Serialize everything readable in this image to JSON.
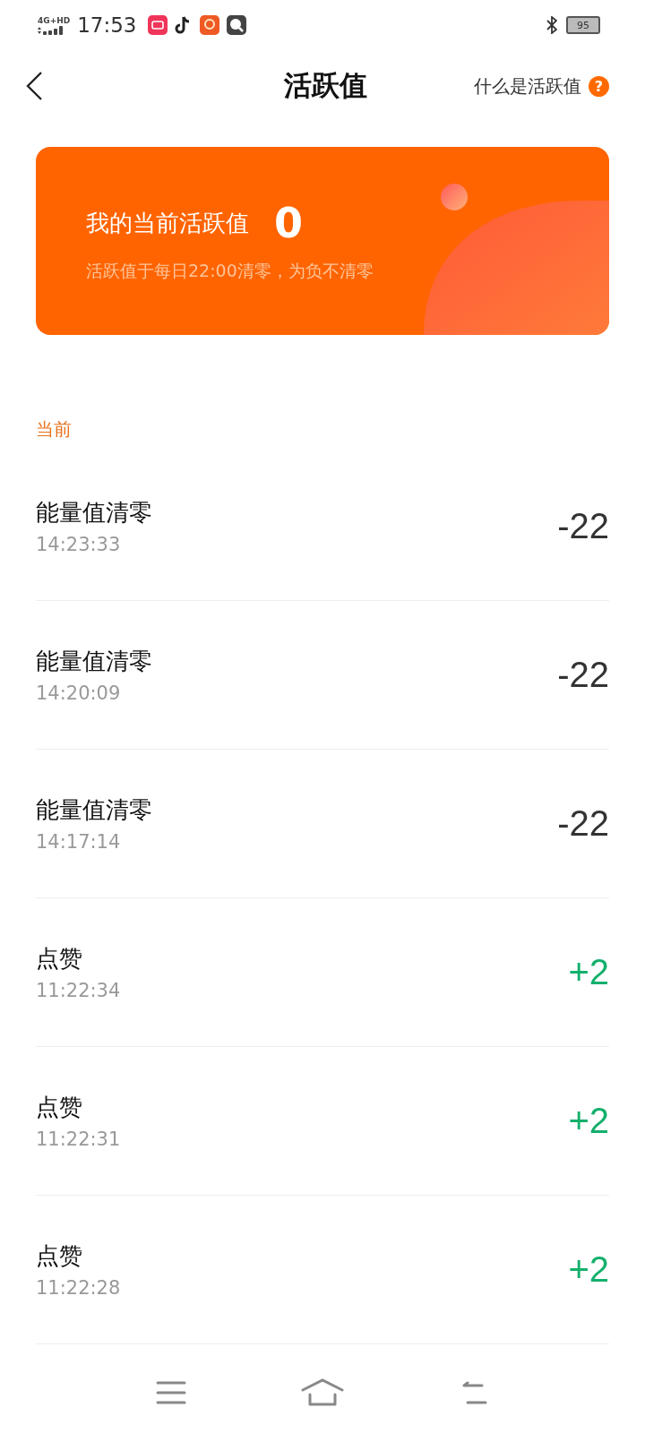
{
  "status_bar": {
    "network": "4G+HD",
    "time": "17:53",
    "battery": "95"
  },
  "header": {
    "title": "活跃值",
    "help_link": "什么是活跃值",
    "help_icon": "?"
  },
  "card": {
    "label": "我的当前活跃值",
    "value": "0",
    "note": "活跃值于每日22:00清零，为负不清零"
  },
  "section": {
    "title": "当前"
  },
  "records": [
    {
      "title": "能量值清零",
      "time": "14:23:33",
      "amount": "-22",
      "kind": "deduct"
    },
    {
      "title": "能量值清零",
      "time": "14:20:09",
      "amount": "-22",
      "kind": "deduct"
    },
    {
      "title": "能量值清零",
      "time": "14:17:14",
      "amount": "-22",
      "kind": "deduct"
    },
    {
      "title": "点赞",
      "time": "11:22:34",
      "amount": "+2",
      "kind": "gain"
    },
    {
      "title": "点赞",
      "time": "11:22:31",
      "amount": "+2",
      "kind": "gain"
    },
    {
      "title": "点赞",
      "time": "11:22:28",
      "amount": "+2",
      "kind": "gain"
    }
  ]
}
